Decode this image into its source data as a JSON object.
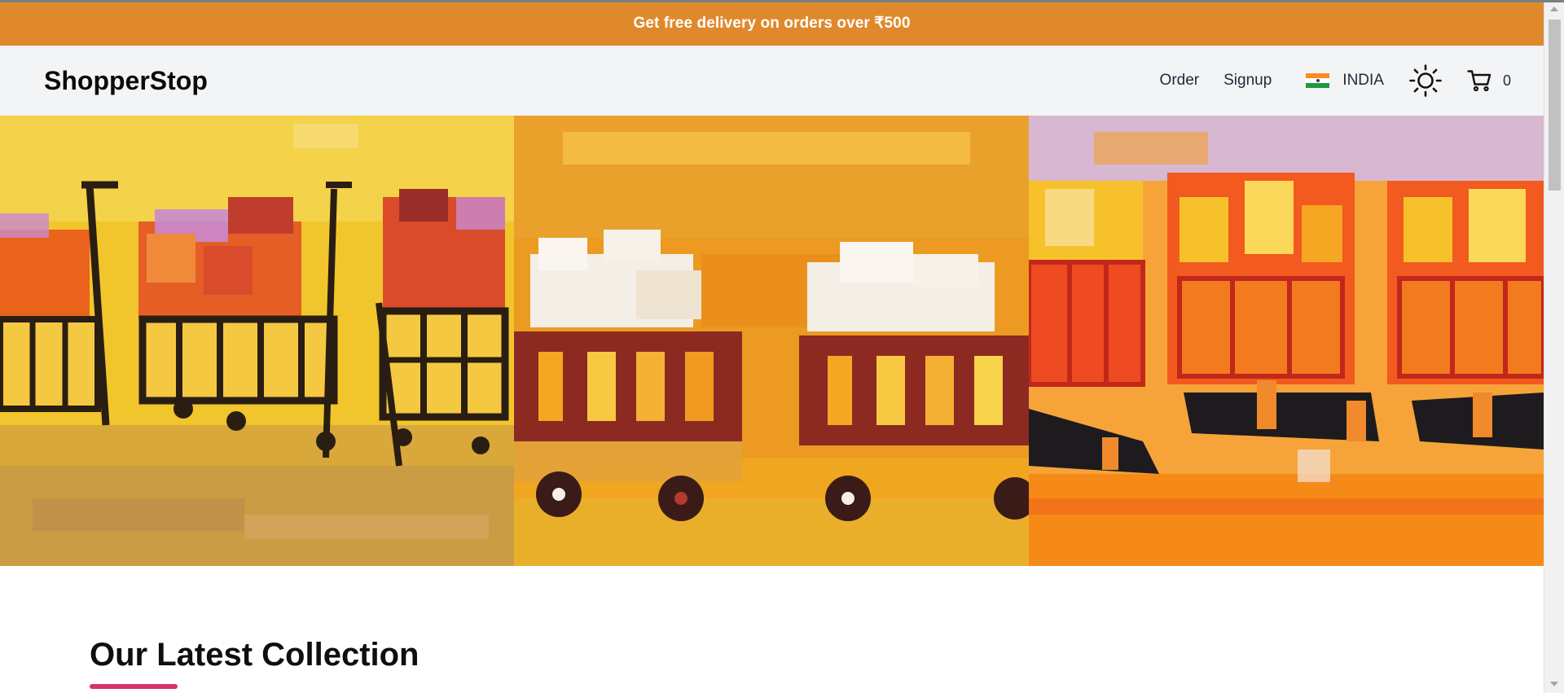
{
  "announcement": {
    "text": "Get free delivery on orders over ₹500"
  },
  "header": {
    "brand": "ShopperStop",
    "nav": {
      "order_label": "Order",
      "signup_label": "Signup"
    },
    "region": {
      "country_label": "INDIA",
      "flag_icon": "india-flag-icon"
    },
    "theme_toggle_icon": "sun-icon",
    "cart": {
      "icon": "cart-icon",
      "count": "0"
    }
  },
  "hero": {
    "panels": [
      {
        "name": "hero-panel-yellow-carts"
      },
      {
        "name": "hero-panel-orange-carts"
      },
      {
        "name": "hero-panel-red-carts"
      }
    ]
  },
  "section": {
    "title": "Our Latest Collection",
    "accent_color": "#d6336c"
  },
  "colors": {
    "announcement_bg": "#e0892c",
    "header_bg": "#f3f4f6"
  }
}
